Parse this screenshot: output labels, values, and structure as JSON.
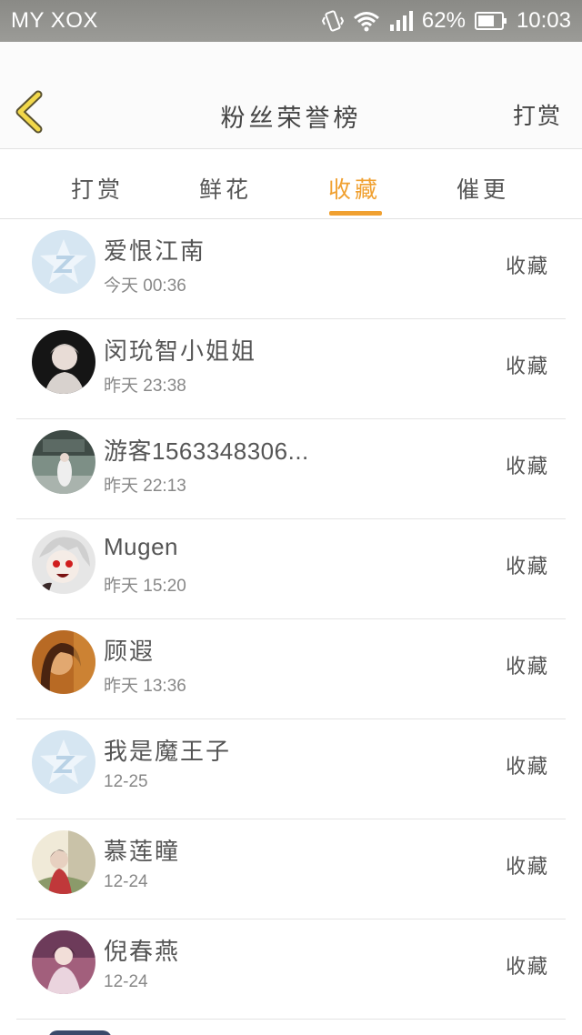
{
  "status_bar": {
    "carrier": "MY XOX",
    "battery_percent": "62%",
    "time": "10:03"
  },
  "header": {
    "title": "粉丝荣誉榜",
    "action": "打赏",
    "back_icon": "chevron-left-icon"
  },
  "tabs": [
    {
      "label": "打赏",
      "active": false
    },
    {
      "label": "鲜花",
      "active": false
    },
    {
      "label": "收藏",
      "active": true
    },
    {
      "label": "催更",
      "active": false
    }
  ],
  "colors": {
    "accent": "#f0a030",
    "status_bar": "#969692"
  },
  "entries": [
    {
      "name": "爱恨江南",
      "date_prefix": "今天",
      "time": "00:36",
      "action": "收藏",
      "avatar": "default-qq-avatar"
    },
    {
      "name": "闵玧智小姐姐",
      "date_prefix": "昨天",
      "time": "23:38",
      "action": "收藏",
      "avatar": "photo-avatar"
    },
    {
      "name": "游客1563348306...",
      "date_prefix": "昨天",
      "time": "22:13",
      "action": "收藏",
      "avatar": "photo-avatar"
    },
    {
      "name": "Mugen",
      "date_prefix": "昨天",
      "time": "15:20",
      "action": "收藏",
      "avatar": "anime-avatar"
    },
    {
      "name": "顾遐",
      "date_prefix": "昨天",
      "time": "13:36",
      "action": "收藏",
      "avatar": "photo-avatar"
    },
    {
      "name": "我是魔王子",
      "date_prefix": "",
      "time": "12-25",
      "action": "收藏",
      "avatar": "default-qq-avatar"
    },
    {
      "name": "慕莲瞳",
      "date_prefix": "",
      "time": "12-24",
      "action": "收藏",
      "avatar": "photo-avatar"
    },
    {
      "name": "倪春燕",
      "date_prefix": "",
      "time": "12-24",
      "action": "收藏",
      "avatar": "photo-avatar"
    }
  ]
}
